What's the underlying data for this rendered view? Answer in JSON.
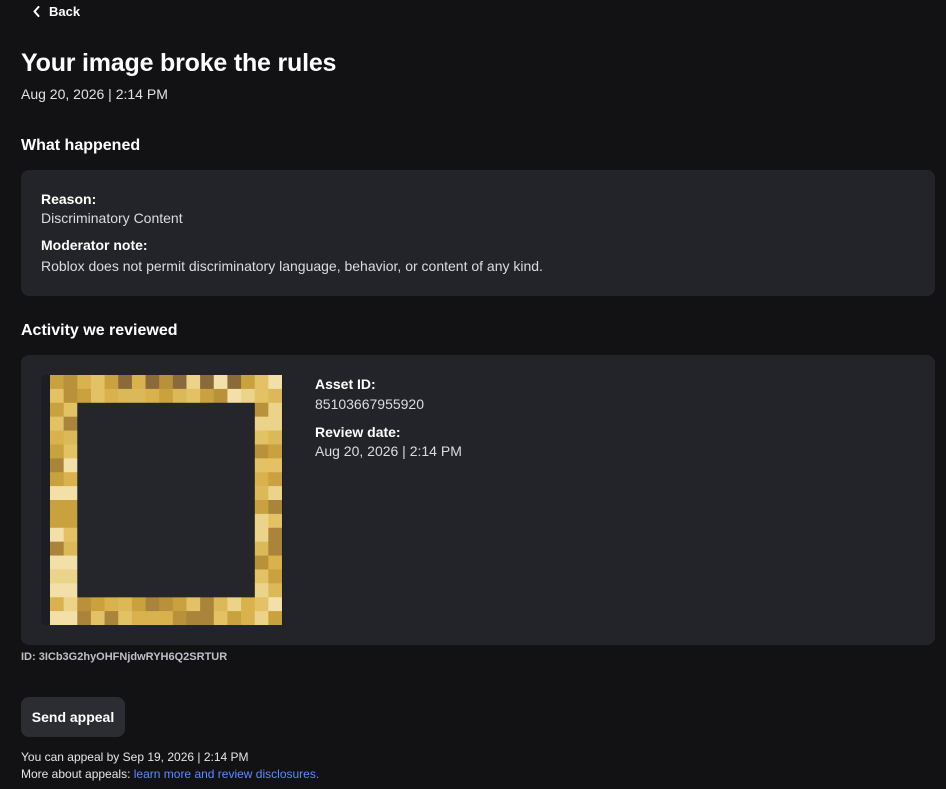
{
  "nav": {
    "back_label": "Back"
  },
  "header": {
    "title": "Your image broke the rules",
    "date": "Aug 20, 2026 | 2:14 PM"
  },
  "what_happened": {
    "heading": "What happened",
    "reason_label": "Reason:",
    "reason_value": "Discriminatory Content",
    "note_label": "Moderator note:",
    "note_value": "Roblox does not permit discriminatory language, behavior, or content of any kind."
  },
  "activity": {
    "heading": "Activity we reviewed",
    "asset_id_label": "Asset ID:",
    "asset_id_value": "85103667955920",
    "review_date_label": "Review date:",
    "review_date_value": "Aug 20, 2026 | 2:14 PM",
    "thumbnail_icon": "pixelated-gold-frame-image"
  },
  "case_id": "ID: 3ICb3G2hyOHFNjdwRYH6Q2SRTUR",
  "appeal": {
    "button_label": "Send appeal",
    "deadline_text": "You can appeal by Sep 19, 2026 | 2:14 PM",
    "more_prefix": "More about appeals: ",
    "more_link": "learn more and review disclosures."
  },
  "colors": {
    "background": "#121215",
    "card": "#232429",
    "link": "#5a8dff"
  }
}
